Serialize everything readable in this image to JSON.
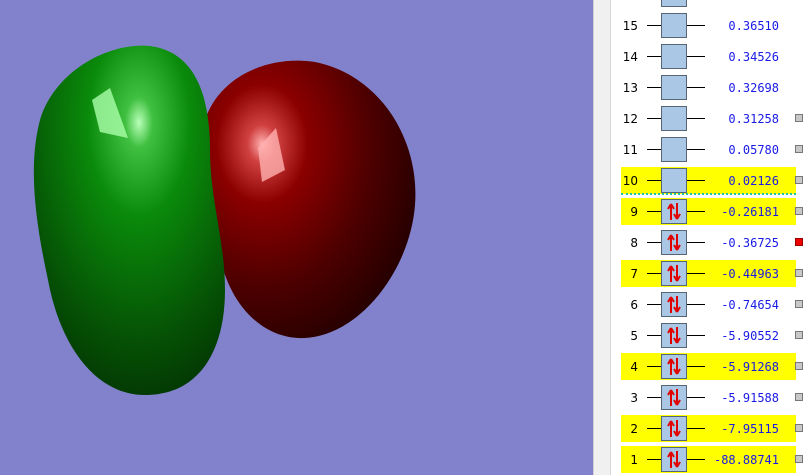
{
  "orbital_viewer": {
    "background": "#8282cc",
    "positive_lobe_color": "#8b0000",
    "negative_lobe_color": "#0a8a0a"
  },
  "mo_panel": {
    "occupied_symbol": "↑↓",
    "homo_lumo_separator_color": "#20c0a0",
    "orbitals": [
      {
        "index": "15",
        "energy": "0.36510",
        "occupied": false,
        "highlighted": false,
        "marker": "none"
      },
      {
        "index": "14",
        "energy": "0.34526",
        "occupied": false,
        "highlighted": false,
        "marker": "none"
      },
      {
        "index": "13",
        "energy": "0.32698",
        "occupied": false,
        "highlighted": false,
        "marker": "none"
      },
      {
        "index": "12",
        "energy": "0.31258",
        "occupied": false,
        "highlighted": false,
        "marker": "gray"
      },
      {
        "index": "11",
        "energy": "0.05780",
        "occupied": false,
        "highlighted": false,
        "marker": "gray"
      },
      {
        "index": "10",
        "energy": "0.02126",
        "occupied": false,
        "highlighted": true,
        "marker": "gray"
      },
      {
        "index": "9",
        "energy": "-0.26181",
        "occupied": true,
        "highlighted": true,
        "marker": "gray"
      },
      {
        "index": "8",
        "energy": "-0.36725",
        "occupied": true,
        "highlighted": false,
        "marker": "red"
      },
      {
        "index": "7",
        "energy": "-0.44963",
        "occupied": true,
        "highlighted": true,
        "marker": "gray"
      },
      {
        "index": "6",
        "energy": "-0.74654",
        "occupied": true,
        "highlighted": false,
        "marker": "gray"
      },
      {
        "index": "5",
        "energy": "-5.90552",
        "occupied": true,
        "highlighted": false,
        "marker": "gray"
      },
      {
        "index": "4",
        "energy": "-5.91268",
        "occupied": true,
        "highlighted": true,
        "marker": "gray"
      },
      {
        "index": "3",
        "energy": "-5.91588",
        "occupied": true,
        "highlighted": false,
        "marker": "gray"
      },
      {
        "index": "2",
        "energy": "-7.95115",
        "occupied": true,
        "highlighted": true,
        "marker": "gray"
      },
      {
        "index": "1",
        "energy": "-88.88741",
        "occupied": true,
        "highlighted": true,
        "marker": "gray"
      }
    ]
  }
}
